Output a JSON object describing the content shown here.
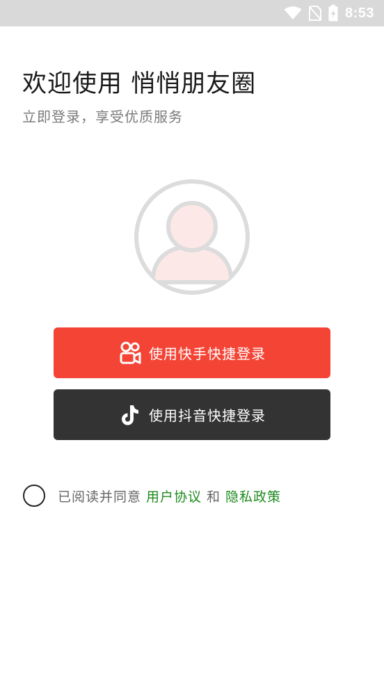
{
  "status_bar": {
    "time": "8:53",
    "icons": [
      "wifi-icon",
      "no-sim-icon",
      "battery-charging-icon"
    ]
  },
  "header": {
    "title": "欢迎使用 悄悄朋友圈",
    "subtitle": "立即登录，享受优质服务"
  },
  "avatar": {
    "icon": "user-avatar-icon"
  },
  "buttons": {
    "kuaishou_label": "使用快手快捷登录",
    "kuaishou_icon": "kuaishou-logo-icon",
    "douyin_label": "使用抖音快捷登录",
    "douyin_icon": "douyin-logo-icon"
  },
  "agreement": {
    "checked": false,
    "prefix": "已阅读并同意",
    "user_agreement": "用户协议",
    "conjunction": "和",
    "privacy_policy": "隐私政策"
  },
  "colors": {
    "kuaishou_button": "#f44436",
    "douyin_button": "#333333",
    "link": "#1e8a1e",
    "status_bar": "#d9d9d9"
  }
}
